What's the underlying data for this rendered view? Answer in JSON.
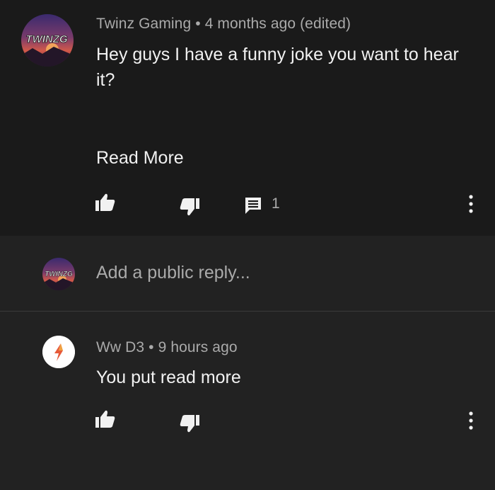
{
  "comment": {
    "author": "Twinz Gaming",
    "separator": "•",
    "time": "4 months ago (edited)",
    "text": "Hey guys I have a funny joke you want to hear it?",
    "read_more": "Read More",
    "reply_count": "1",
    "avatar_text": "TWINZG"
  },
  "reply_box": {
    "placeholder": "Add a public reply...",
    "avatar_text": "TWINZG"
  },
  "reply": {
    "author": "Ww D3",
    "separator": "•",
    "time": "9 hours ago",
    "text": "You put read more"
  },
  "colors": {
    "background": "#1a1a1a",
    "panel": "#222222",
    "text_primary": "#f1f1f1",
    "text_secondary": "#aaaaaa"
  }
}
